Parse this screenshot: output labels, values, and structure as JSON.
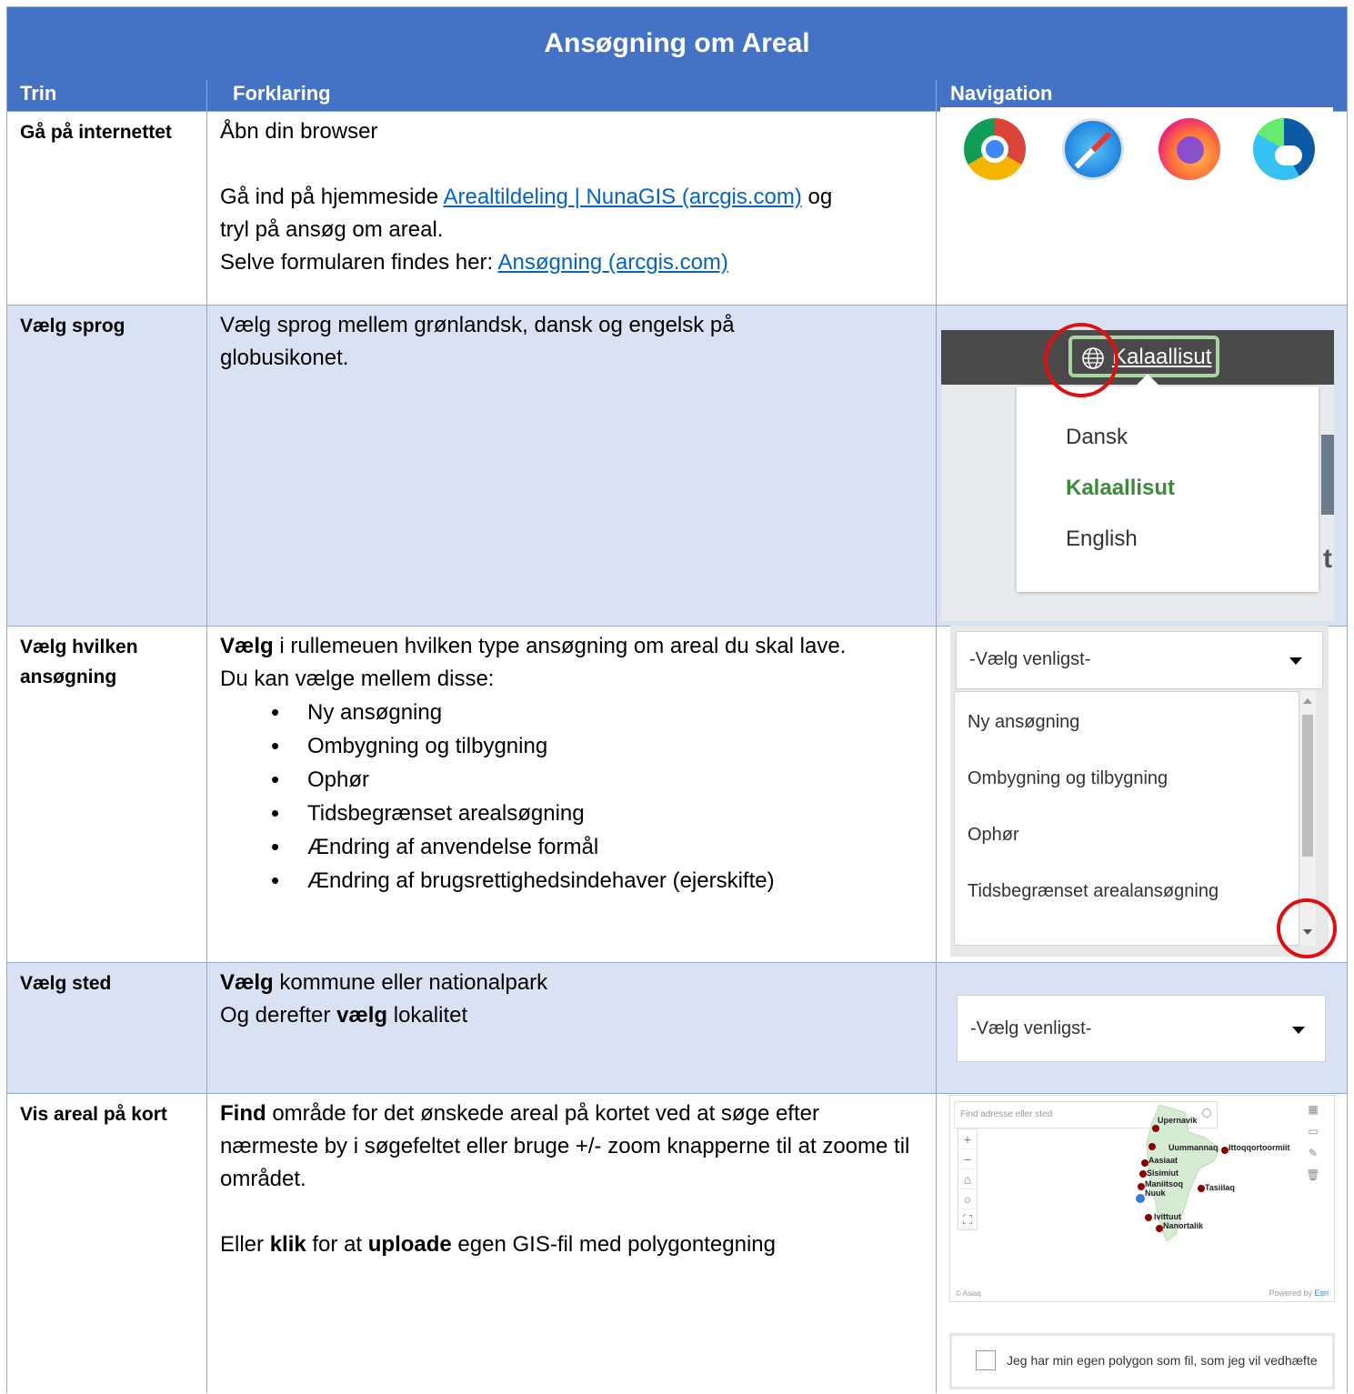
{
  "title": "Ansøgning om Areal",
  "headers": {
    "step": "Trin",
    "explanation": "Forklaring",
    "navigation": "Navigation"
  },
  "rows": [
    {
      "step": "Gå på internettet",
      "lines": [
        {
          "text": "Åbn din browser"
        },
        {
          "text": ""
        },
        {
          "before": "Gå ind på hjemmeside ",
          "link": "Arealtildeling | NunaGIS (arcgis.com)",
          "after": " og"
        },
        {
          "text": "tryl på ansøg om areal."
        },
        {
          "before": "Selve formularen findes her: ",
          "link": "Ansøgning (arcgis.com)",
          "after": ""
        }
      ]
    },
    {
      "step": "Vælg sprog",
      "text": "Vælg sprog mellem grønlandsk, dansk og engelsk på globusikonet."
    },
    {
      "step": "Vælg hvilken ansøgning",
      "intro_bold": "Vælg",
      "intro_rest": " i rullemeuen hvilken type ansøgning om areal du skal lave.",
      "intro2": "Du kan vælge mellem disse:",
      "options": [
        "Ny ansøgning",
        "Ombygning og tilbygning",
        "Ophør",
        "Tidsbegrænset arealsøgning",
        "Ændring af anvendelse formål",
        "Ændring af brugsrettighedsindehaver (ejerskifte)"
      ]
    },
    {
      "step": "Vælg sted",
      "l1_bold": "Vælg",
      "l1_rest": " kommune eller nationalpark",
      "l2_pre": "Og derefter ",
      "l2_bold": "vælg",
      "l2_rest": " lokalitet"
    },
    {
      "step": "Vis areal på kort",
      "p1_bold": "Find",
      "p1_rest": " område for det ønskede areal på kortet ved at søge efter nærmeste by i søgefeltet eller bruge +/- zoom knapperne til at zoome til området.",
      "p2_pre": "Eller ",
      "p2_bold1": "klik",
      "p2_mid": " for at ",
      "p2_bold2": "uploade",
      "p2_rest": " egen GIS-fil med polygontegning"
    }
  ],
  "browser_icons": [
    "chrome-icon",
    "safari-icon",
    "firefox-icon",
    "edge-icon"
  ],
  "language_menu": {
    "current": "Kalaallisut",
    "options": [
      "Dansk",
      "Kalaallisut",
      "English"
    ],
    "active_index": 1,
    "partial_char": "t"
  },
  "type_dropdown": {
    "placeholder": "-Vælg venligst-",
    "items": [
      "Ny ansøgning",
      "Ombygning og tilbygning",
      "Ophør",
      "Tidsbegrænset arealansøgning"
    ]
  },
  "place_dropdown": {
    "placeholder": "-Vælg venligst-"
  },
  "map": {
    "search_placeholder": "Find adresse eller sted",
    "towns": [
      "Upernavik",
      "Uummannaq",
      "Ittoqqortoormiit",
      "Aasiaat",
      "Sisimiut",
      "Maniitsoq",
      "Tasiilaq",
      "Nuuk",
      "Ivittuut",
      "Nanortalik"
    ],
    "attribution": "© Asiaq",
    "powered_pre": "Powered by ",
    "powered_brand": "Esri"
  },
  "checkbox_label": "Jeg har min egen polygon som fil, som jeg vil vedhæfte",
  "colors": {
    "header_blue": "#4472c4",
    "row_alt": "#d9e2f3",
    "link": "#0563c1",
    "highlight_red": "#e01010",
    "active_green": "#3a8a3a"
  }
}
